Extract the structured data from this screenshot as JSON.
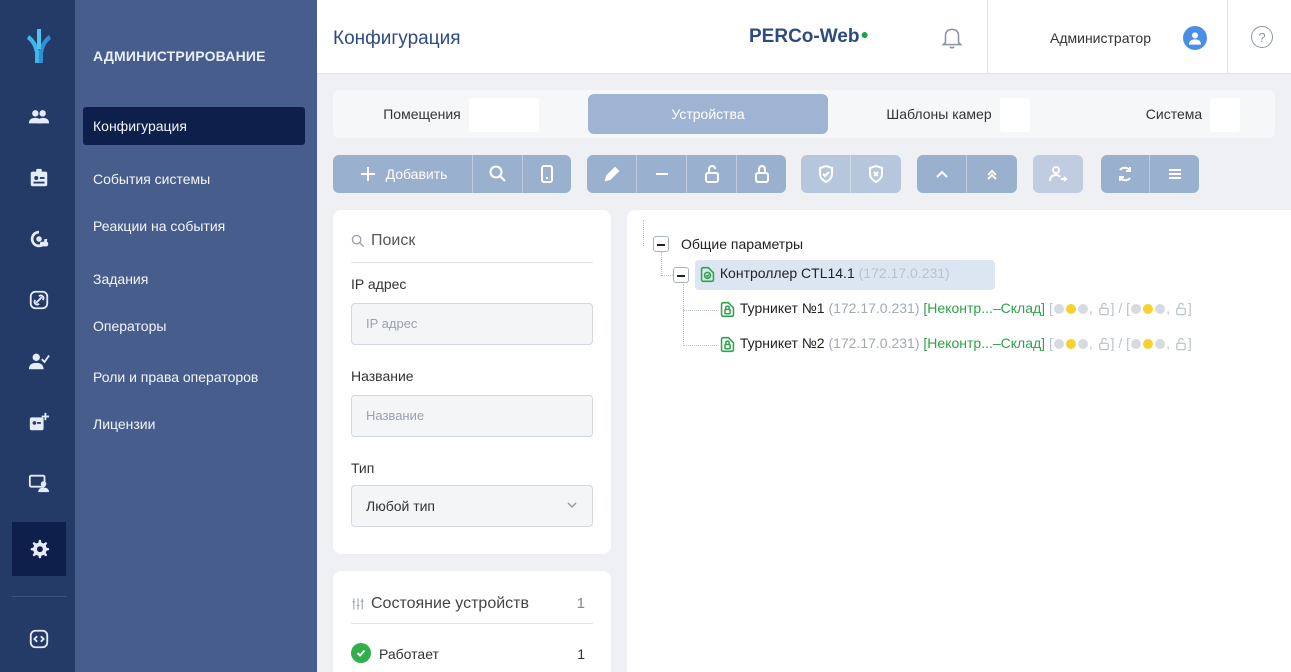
{
  "rail": {
    "items": [
      {
        "icon": "logo-icon"
      },
      {
        "icon": "users-icon"
      },
      {
        "icon": "id-badge-icon"
      },
      {
        "icon": "target-icon"
      },
      {
        "icon": "link-icon"
      },
      {
        "icon": "person-check-icon"
      },
      {
        "icon": "badge-add-icon"
      },
      {
        "icon": "monitor-user-icon"
      },
      {
        "icon": "gear-icon",
        "active": true
      },
      {
        "icon": "code-icon"
      }
    ]
  },
  "nav": {
    "title": "АДМИНИСТРИРОВАНИЕ",
    "items": [
      {
        "label": "Конфигурация",
        "active": true
      },
      {
        "label": "События системы"
      },
      {
        "label": "Реакции на события"
      },
      {
        "label": "Задания"
      },
      {
        "label": "Операторы"
      },
      {
        "label": "Роли и права операторов"
      },
      {
        "label": "Лицензии"
      }
    ]
  },
  "header": {
    "title": "Конфигурация",
    "brand": "PERCo-Web",
    "user": "Администратор",
    "help": "?"
  },
  "tabs": [
    {
      "label": "Помещения"
    },
    {
      "label": "Устройства",
      "active": true
    },
    {
      "label": "Шаблоны камер"
    },
    {
      "label": "Система"
    }
  ],
  "toolbar": {
    "add_label": "Добавить"
  },
  "filter": {
    "search_label": "Поиск",
    "ip_label": "IP адрес",
    "ip_placeholder": "IP адрес",
    "name_label": "Название",
    "name_placeholder": "Название",
    "type_label": "Тип",
    "type_value": "Любой тип"
  },
  "status_panel": {
    "title": "Состояние устройств",
    "total": "1",
    "rows": [
      {
        "label": "Работает",
        "count": "1"
      }
    ]
  },
  "tree": {
    "root": "Общие параметры",
    "controller": {
      "name": "Контроллер CTL14.1",
      "ip": "(172.17.0.231)"
    },
    "children": [
      {
        "name": "Турникет №1",
        "ip": "(172.17.0.231)",
        "zone": "[Неконтр...–Склад]"
      },
      {
        "name": "Турникет №2",
        "ip": "(172.17.0.231)",
        "zone": "[Неконтр...–Склад]"
      }
    ]
  },
  "colors": {
    "rail": "#243a67",
    "nav": "#475e8c",
    "active": "#0d1f4a",
    "accent": "#9ab0cf",
    "green": "#2fa24a"
  }
}
